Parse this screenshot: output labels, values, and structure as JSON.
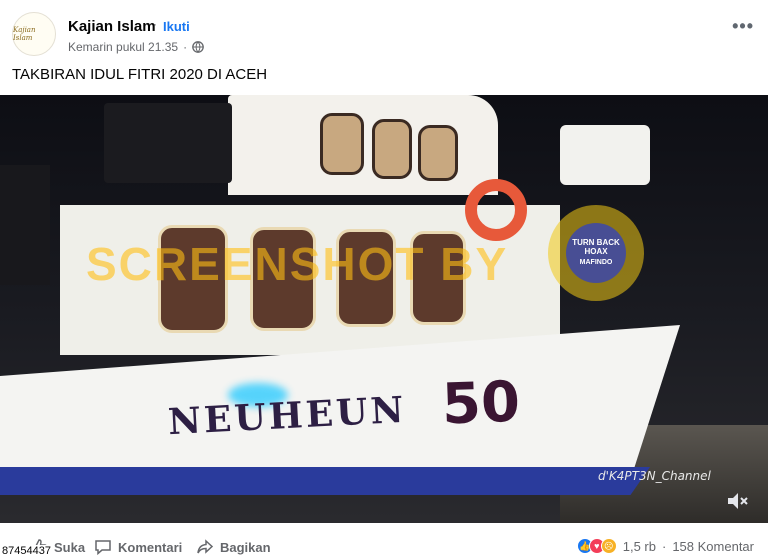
{
  "post": {
    "avatar_text": "Kajian Islam",
    "page_name": "Kajian Islam",
    "separator": "·",
    "follow_label": "Ikuti",
    "timestamp": "Kemarin pukul 21.35",
    "more_label": "•••",
    "caption": "TAKBIRAN IDUL FITRI 2020 DI ACEH"
  },
  "video": {
    "overlay_watermark": "SCREENSHOT BY",
    "stamp_text": "TURN BACK HOAX",
    "stamp_org": "MAFINDO",
    "boat_name": "NEUHEUN",
    "boat_number": "50",
    "channel_credit": "d'K4PT3N_Channel",
    "view_count": "87454437"
  },
  "actions": {
    "like_label": "Suka",
    "comment_label": "Komentari",
    "share_label": "Bagikan"
  },
  "reactions": {
    "count": "1,5 rb",
    "separator": "·",
    "comments": "158 Komentar",
    "types": [
      "like-icon",
      "love-icon",
      "sad-icon"
    ],
    "colors": {
      "like": "#1877f2",
      "love": "#f33e58",
      "sad": "#f7b125"
    }
  },
  "colors": {
    "accent": "#1877f2",
    "secondary_text": "#65676b"
  }
}
